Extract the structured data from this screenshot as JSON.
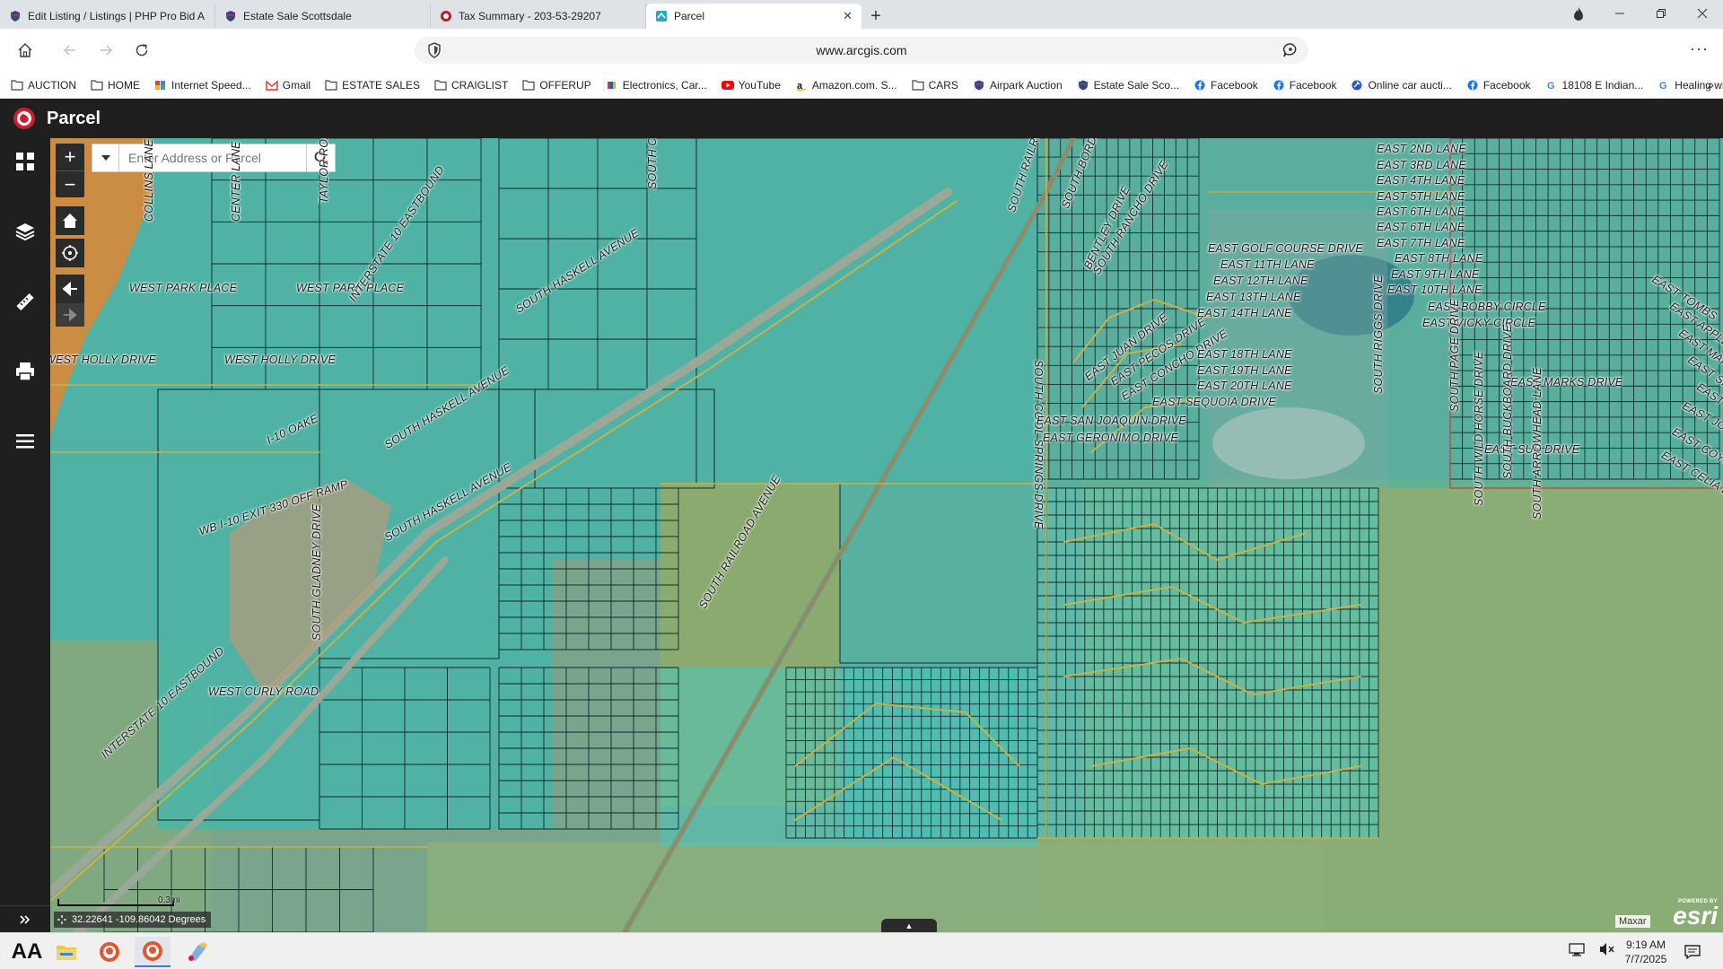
{
  "browser": {
    "tabs": [
      {
        "title": "Edit Listing / Listings | PHP Pro Bid A",
        "active": false
      },
      {
        "title": "Estate Sale Scottsdale",
        "active": false
      },
      {
        "title": "Tax Summary - 203-53-29207",
        "active": false
      },
      {
        "title": "Parcel",
        "active": true
      }
    ],
    "close_glyph": "✕",
    "new_tab_glyph": "+",
    "url": "www.arcgis.com",
    "menu_glyph": "···",
    "bookmarks_overflow_glyph": "»"
  },
  "bookmarks": [
    {
      "label": "AUCTION",
      "icon": "folder-icon"
    },
    {
      "label": "HOME",
      "icon": "folder-icon"
    },
    {
      "label": "Internet Speed...",
      "icon": "speedtest-icon"
    },
    {
      "label": "Gmail",
      "icon": "gmail-icon"
    },
    {
      "label": "ESTATE SALES",
      "icon": "folder-icon"
    },
    {
      "label": "CRAIGLIST",
      "icon": "folder-icon"
    },
    {
      "label": "OFFERUP",
      "icon": "folder-icon"
    },
    {
      "label": "Electronics, Car...",
      "icon": "ebay-icon"
    },
    {
      "label": "YouTube",
      "icon": "youtube-icon"
    },
    {
      "label": "Amazon.com. S...",
      "icon": "amazon-icon"
    },
    {
      "label": "CARS",
      "icon": "folder-icon"
    },
    {
      "label": "Airpark Auction",
      "icon": "shield-bookmark-icon"
    },
    {
      "label": "Estate Sale Sco...",
      "icon": "shield-bookmark-icon"
    },
    {
      "label": "Facebook",
      "icon": "facebook-icon"
    },
    {
      "label": "Facebook",
      "icon": "facebook-icon"
    },
    {
      "label": "Online car aucti...",
      "icon": "auction-icon"
    },
    {
      "label": "Facebook",
      "icon": "facebook-icon"
    },
    {
      "label": "18108 E Indian...",
      "icon": "google-icon"
    },
    {
      "label": "Healing with M...",
      "icon": "google-icon"
    }
  ],
  "app": {
    "title": "Parcel"
  },
  "map": {
    "zoom_in": "+",
    "zoom_out": "−",
    "search_placeholder": "Enter Address or Parcel",
    "scale_label": "0.3mi",
    "coordinates": "32.22641 -109.86042 Degrees",
    "basemap_credit": "Maxar",
    "esri_powered": "POWERED BY",
    "esri_word": "esri",
    "attribution_tab_glyph": "▲",
    "colors": {
      "parcel_teal": "#3fb7ad",
      "agri_green": "#8dae72",
      "orange_zone": "#d4893c",
      "road": "#c9b24a"
    },
    "streets": [
      "WEST PARK PLACE",
      "WEST PARK PLACE",
      "WEST HOLLY DRIVE",
      "WEST HOLLY DRIVE",
      "WEST CURLY ROAD",
      "INTERSTATE 10 EASTBOUND",
      "INTERSTATE 10 EASTBOUND",
      "WB I-10 EXIT 330 OFF RAMP",
      "SOUTH HASKELL AVENUE",
      "SOUTH HASKELL AVENUE",
      "SOUTH HASKELL AVENUE",
      "SOUTH RAILROAD AVENUE",
      "SOUTH GLADNEY DRIVE",
      "CENTER LANE",
      "COLLINS LANE",
      "TAYLOR ROAD",
      "SOUTH CHURCH ROAD",
      "I-10 OAKE",
      "SOUTH RAILROAD",
      "SOUTH BORDER",
      "SOUTH COOL SPRINGS DRIVE",
      "BENTLEY DRIVE",
      "SOUTH RANCHO DRIVE",
      "EAST GOLF COURSE DRIVE",
      "EAST 11TH LANE",
      "EAST 12TH LANE",
      "EAST 13TH LANE",
      "EAST 14TH LANE",
      "EAST JUAN DRIVE",
      "EAST PECOS DRIVE",
      "EAST CONCHO DRIVE",
      "EAST 18TH LANE",
      "EAST 19TH LANE",
      "EAST 20TH LANE",
      "EAST SEQUOIA DRIVE",
      "EAST SAN JOAQUIN DRIVE",
      "EAST GERONIMO DRIVE",
      "EAST 2ND LANE",
      "EAST 3RD LANE",
      "EAST 4TH LANE",
      "EAST 5TH LANE",
      "EAST 6TH LANE",
      "EAST 6TH LANE",
      "EAST 7TH LANE",
      "EAST 8TH LANE",
      "EAST 9TH LANE",
      "EAST 10TH LANE",
      "EAST BOBBY CIRCLE",
      "EAST VICKY CIRCLE",
      "EAST MARKS DRIVE",
      "EAST SUE DRIVE",
      "SOUTH RIGGS DRIVE",
      "SOUTH PAGE DRIVE",
      "SOUTH WILD HORSE DRIVE",
      "SOUTH BUCKBOARD DRIVE",
      "SOUTH ARROWHEAD LANE",
      "EAST TOMBS",
      "EAST APPLE",
      "EAST MARLA",
      "EAST SHERRY",
      "EAST HARVEY",
      "EAST JODY DRIVE",
      "EAST COYOTE DRIVE",
      "EAST CELIA DRIVE"
    ]
  },
  "taskbar": {
    "text_icon": "AA",
    "time": "9:19 AM",
    "date": "7/7/2025"
  }
}
